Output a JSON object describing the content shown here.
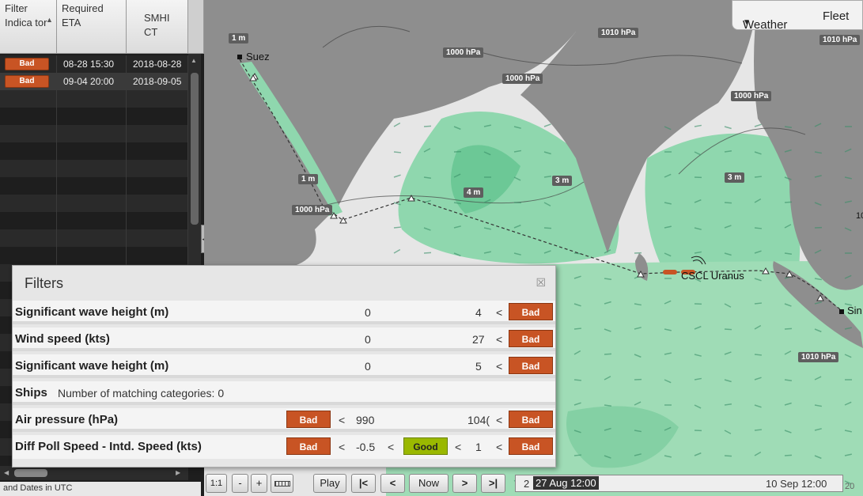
{
  "left_table": {
    "headers": {
      "filter_indicator": "Filter Indica tor",
      "required_eta": "Required ETA",
      "smhi_ct": "SMHI CT"
    },
    "rows": [
      {
        "indicator": "Bad",
        "eta": "08-28 15:30",
        "smhi": "2018-08-28"
      },
      {
        "indicator": "Bad",
        "eta": "09-04 20:00",
        "smhi": "2018-09-05"
      }
    ],
    "footer": "and Dates in UTC",
    "collapse_glyph": "◀"
  },
  "map": {
    "pressure_labels": [
      "1010 hPa",
      "1010 hPa",
      "1000 hPa",
      "1000 hPa",
      "1000 hPa",
      "1000 hPa",
      "1010 hPa"
    ],
    "wave_labels": [
      "1 m",
      "1 m",
      "4 m",
      "3 m",
      "3 m"
    ],
    "place_labels": {
      "suez": "Suez",
      "ship": "CSCL Uranus",
      "sin": "Sin",
      "edge": "10"
    }
  },
  "top_right": {
    "weather": "Weather",
    "fleet": "Fleet"
  },
  "filters": {
    "title": "Filters",
    "close": "☒",
    "rows": [
      {
        "label": "Significant wave height (m)",
        "min": "0",
        "max": "4",
        "lt": "<",
        "status": "Bad"
      },
      {
        "label": "Wind speed (kts)",
        "min": "0",
        "max": "27",
        "lt": "<",
        "status": "Bad"
      },
      {
        "label": "Significant wave height (m)",
        "min": "0",
        "max": "5",
        "lt": "<",
        "status": "Bad"
      }
    ],
    "ships": {
      "label": "Ships",
      "text": "Number of matching categories: 0"
    },
    "air": {
      "label": "Air pressure (hPa)",
      "left_status": "Bad",
      "lt1": "<",
      "low": "990",
      "high": "104(",
      "lt2": "<",
      "right_status": "Bad"
    },
    "diff": {
      "label": "Diff Poll Speed - Intd. Speed (kts)",
      "left_status": "Bad",
      "lt1": "<",
      "low": "-0.5",
      "lt2": "<",
      "mid_status": "Good",
      "lt3": "<",
      "high": "1",
      "lt4": "<",
      "right_status": "Bad"
    }
  },
  "bottom": {
    "scale": "1:1",
    "minus": "-",
    "plus": "+",
    "play": "Play",
    "first": "|<",
    "prev": "<",
    "now": "Now",
    "next": ">",
    "last": ">|",
    "timeline_left_prefix": "2",
    "timeline_current": "27 Aug 12:00",
    "timeline_right": "10 Sep 12:00",
    "timeline_edge": "20"
  }
}
